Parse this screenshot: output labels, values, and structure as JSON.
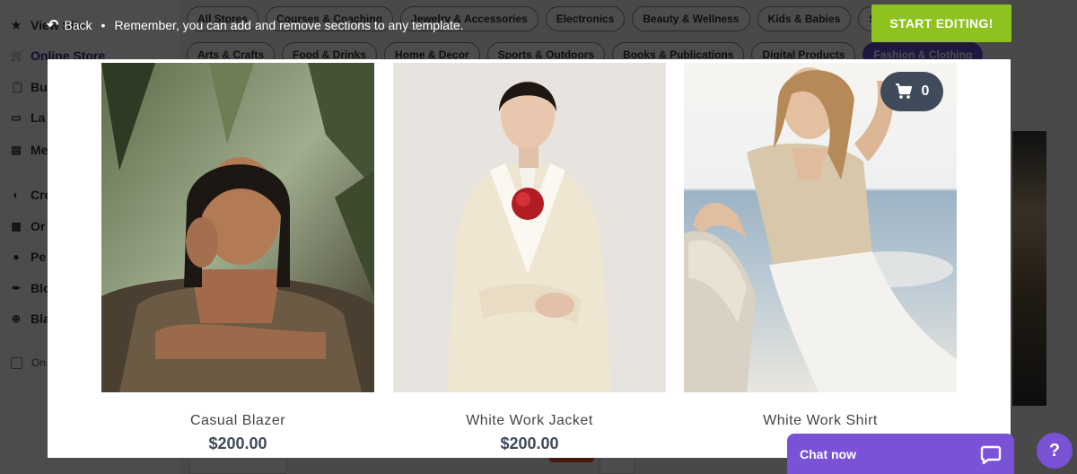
{
  "background": {
    "sidebar": {
      "items": [
        {
          "icon": "star-icon",
          "glyph": "★",
          "label": "View Site"
        },
        {
          "icon": "cart-icon",
          "glyph": "🛒",
          "label": "Online Store",
          "active": true
        },
        {
          "icon": "clipboard-icon",
          "glyph": "📋",
          "label": "Bu"
        },
        {
          "icon": "window-icon",
          "glyph": "▭",
          "label": "La"
        },
        {
          "icon": "id-card-icon",
          "glyph": "▤",
          "label": "Me"
        },
        {
          "icon": "palette-icon",
          "glyph": "◐",
          "label": "Cre"
        },
        {
          "icon": "calendar-icon",
          "glyph": "▦",
          "label": "Or"
        },
        {
          "icon": "person-icon",
          "glyph": "●",
          "label": "Pe"
        },
        {
          "icon": "quill-icon",
          "glyph": "✒",
          "label": "Blo"
        },
        {
          "icon": "plus-circle-icon",
          "glyph": "⊕",
          "label": "Bla"
        }
      ],
      "checkbox_label": "On"
    },
    "categories_row1": [
      "All Stores",
      "Courses & Coaching",
      "Jewelry & Accessories",
      "Electronics",
      "Beauty & Wellness",
      "Kids & Babies",
      "S"
    ],
    "categories_row2": [
      "Arts & Crafts",
      "Food & Drinks",
      "Home & Decor",
      "Sports & Outdoors",
      "Books & Publications",
      "Digital Products",
      "Fashion & Clothing"
    ],
    "active_category": "Fashion & Clothing"
  },
  "topbar": {
    "back_label": "Back",
    "separator": "•",
    "message": "Remember, you can add and remove sections to any template."
  },
  "start_button_label": "START EDITING!",
  "cart": {
    "count": "0"
  },
  "products": [
    {
      "name": "Casual Blazer",
      "price": "$200.00"
    },
    {
      "name": "White Work Jacket",
      "price": "$200.00"
    },
    {
      "name": "White Work Shirt",
      "price": "$200.00"
    }
  ],
  "chat": {
    "label": "Chat now"
  },
  "help": {
    "label": "?"
  },
  "colors": {
    "accent_green": "#8dc21f",
    "chat_purple": "#7a52d6",
    "cart_slate": "#3f4a5a",
    "category_active": "#6c4fd6"
  }
}
